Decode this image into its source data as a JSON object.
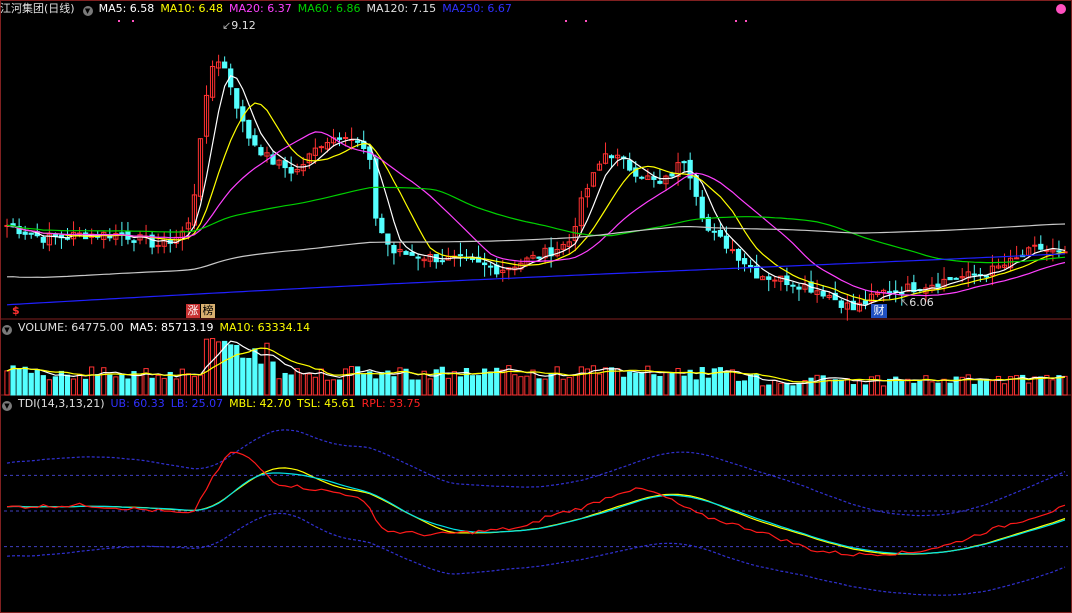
{
  "main_header": {
    "stock_name": "江河集团(日线)",
    "ma5": "MA5: 6.58",
    "ma10": "MA10: 6.48",
    "ma20": "MA20: 6.37",
    "ma60": "MA60: 6.86",
    "ma120": "MA120: 7.15",
    "ma250": "MA250: 6.67"
  },
  "volume_header": {
    "volume": "VOLUME: 64775.00",
    "ma5": "MA5: 85713.19",
    "ma10": "MA10: 63334.14"
  },
  "tdi_header": {
    "name": "TDI(14,3,13,21)",
    "ub": "UB: 60.33",
    "lb": "LB: 25.07",
    "mbl": "MBL: 42.70",
    "tsl": "TSL: 45.61",
    "rpl": "RPL: 53.75"
  },
  "markers": {
    "high_label": "9.12",
    "low_label": "6.06",
    "dollar": "$",
    "zhang": "涨",
    "bang": "榜",
    "cai": "财"
  },
  "colors": {
    "up": "#ff3232",
    "down": "#54ffff",
    "ma5": "#ffffff",
    "ma10": "#ffff00",
    "ma20": "#ff40ff",
    "ma60": "#00d000",
    "ma120": "#c8c8c8",
    "ma250": "#2020ff",
    "mbl": "#ffff00",
    "tsl": "#00e5e5",
    "rpl": "#ff1a1a",
    "band": "#3030d0"
  },
  "chart_data": [
    {
      "type": "candlestick",
      "panel": "price",
      "price_range": [
        5.9,
        9.3
      ],
      "high": 9.12,
      "low": 6.06,
      "ma_lines": [
        "MA5",
        "MA10",
        "MA20",
        "MA60",
        "MA120",
        "MA250"
      ]
    },
    {
      "type": "bar",
      "panel": "volume",
      "series": [
        "VOLUME",
        "MA5",
        "MA10"
      ],
      "last_volume": 64775.0
    },
    {
      "type": "line",
      "panel": "tdi",
      "series": [
        "UB",
        "LB",
        "MBL",
        "TSL",
        "RPL"
      ],
      "y_range": [
        0,
        100
      ],
      "last_values": {
        "UB": 60.33,
        "LB": 25.07,
        "MBL": 42.7,
        "TSL": 45.61,
        "RPL": 53.75
      }
    }
  ]
}
